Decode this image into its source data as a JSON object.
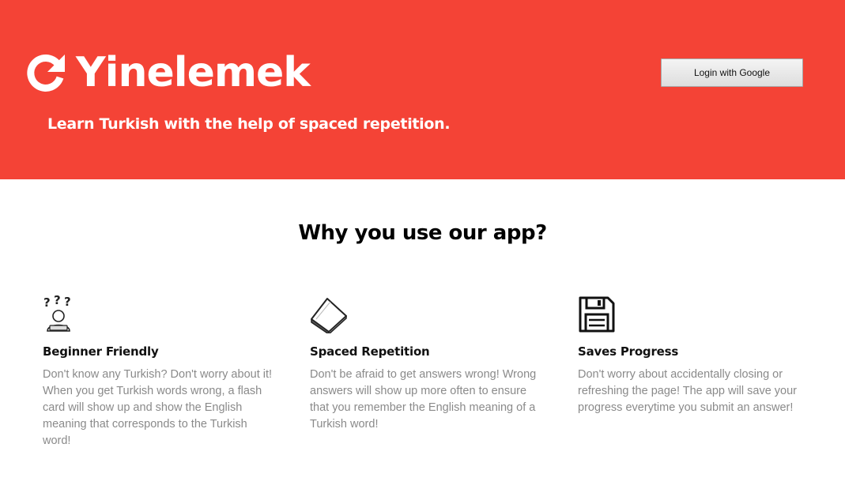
{
  "header": {
    "brand_icon": "refresh-arrow-icon",
    "title": "Yinelemek",
    "tagline": "Learn Turkish with the help of spaced repetition.",
    "login_label": "Login with Google",
    "background_color": "#f44336"
  },
  "main": {
    "section_title": "Why you use our app?",
    "features": [
      {
        "icon": "confused-person-icon",
        "heading": "Beginner Friendly",
        "text": "Don't know any Turkish? Don't worry about it! When you get Turkish words wrong, a flash card will show up and show the English meaning that corresponds to the Turkish word!"
      },
      {
        "icon": "flash-card-icon",
        "heading": "Spaced Repetition",
        "text": "Don't be afraid to get answers wrong! Wrong answers will show up more often to ensure that you remember the English meaning of a Turkish word!"
      },
      {
        "icon": "floppy-disk-icon",
        "heading": "Saves Progress",
        "text": "Don't worry about accidentally closing or refreshing the page! The app will save your progress everytime you submit an answer!"
      }
    ]
  }
}
